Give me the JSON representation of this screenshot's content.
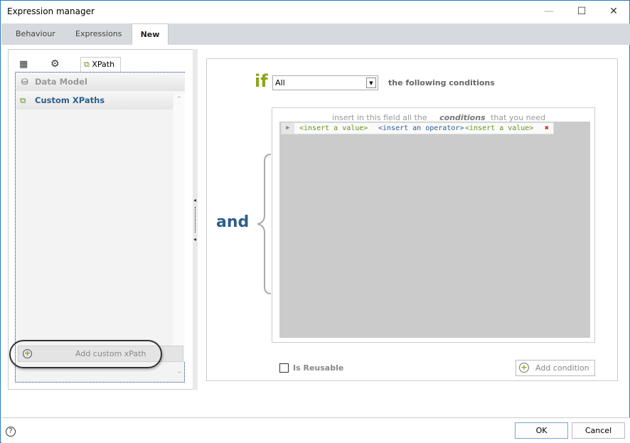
{
  "window": {
    "title": "Expression manager"
  },
  "tabs": [
    {
      "label": "Behaviour"
    },
    {
      "label": "Expressions"
    },
    {
      "label": "New"
    }
  ],
  "left_panel": {
    "tool_tabs": [
      {
        "icon": "table-icon"
      },
      {
        "icon": "gear-icon"
      },
      {
        "icon": "xpath-icon",
        "label": "XPath"
      }
    ],
    "items": [
      {
        "label": "Data Model",
        "icon": "database-icon"
      },
      {
        "label": "Custom XPaths",
        "icon": "xpath-icon"
      }
    ],
    "add_button": "Add custom xPath"
  },
  "builder": {
    "if_label": "if",
    "match_select": "All",
    "following": "the following conditions",
    "and_label": "and",
    "hint_prefix": "insert in this field all the",
    "hint_emphasis": "conditions",
    "hint_suffix": "that you need",
    "condition": {
      "left": "<insert a value>",
      "operator": "<insert an operator>",
      "right": "<insert a value>"
    },
    "is_reusable": "Is Reusable",
    "is_reusable_checked": false,
    "add_condition": "Add condition"
  },
  "footer": {
    "ok": "OK",
    "cancel": "Cancel"
  },
  "colors": {
    "accent_green": "#8aa61a",
    "and_blue": "#2e5f8a",
    "value_green": "#6a8f1a",
    "operator_blue": "#2a5d8f",
    "remove_red": "#d42020"
  }
}
